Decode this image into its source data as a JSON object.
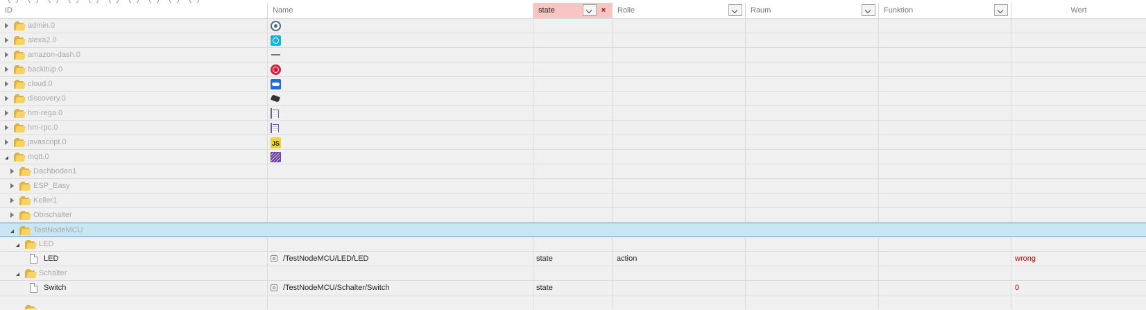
{
  "header": {
    "id": "ID",
    "name": "Name",
    "state_filter": "state",
    "clear_filter": "×",
    "rolle": "Rolle",
    "raum": "Raum",
    "funktion": "Funktion",
    "wert": "Wert"
  },
  "rows": [
    {
      "id": "admin.0",
      "icon": "admin-gear-icon"
    },
    {
      "id": "alexa2.0",
      "icon": "alexa-icon"
    },
    {
      "id": "amazon-dash.0",
      "icon": "dash-button-icon"
    },
    {
      "id": "backitup.0",
      "icon": "backitup-icon"
    },
    {
      "id": "cloud.0",
      "icon": "cloud-icon"
    },
    {
      "id": "discovery.0",
      "icon": "binoculars-icon"
    },
    {
      "id": "hm-rega.0",
      "icon": "homematic-icon"
    },
    {
      "id": "hm-rpc.0",
      "icon": "homematic-icon"
    },
    {
      "id": "javascript.0",
      "icon": "javascript-icon",
      "icon_text": "JS"
    },
    {
      "id": "mqtt.0",
      "icon": "mqtt-icon"
    },
    {
      "id": "Dachboden1"
    },
    {
      "id": "ESP_Easy"
    },
    {
      "id": "Keller1"
    },
    {
      "id": "Obischalter"
    },
    {
      "id": "TestNodeMCU"
    },
    {
      "id": "LED"
    },
    {
      "id": "LED",
      "name": "/TestNodeMCU/LED/LED",
      "type": "state",
      "role": "action",
      "value": "wrong"
    },
    {
      "id": "Schalter"
    },
    {
      "id": "Switch",
      "name": "/TestNodeMCU/Schalter/Switch",
      "type": "state",
      "role": "",
      "value": "0"
    }
  ]
}
